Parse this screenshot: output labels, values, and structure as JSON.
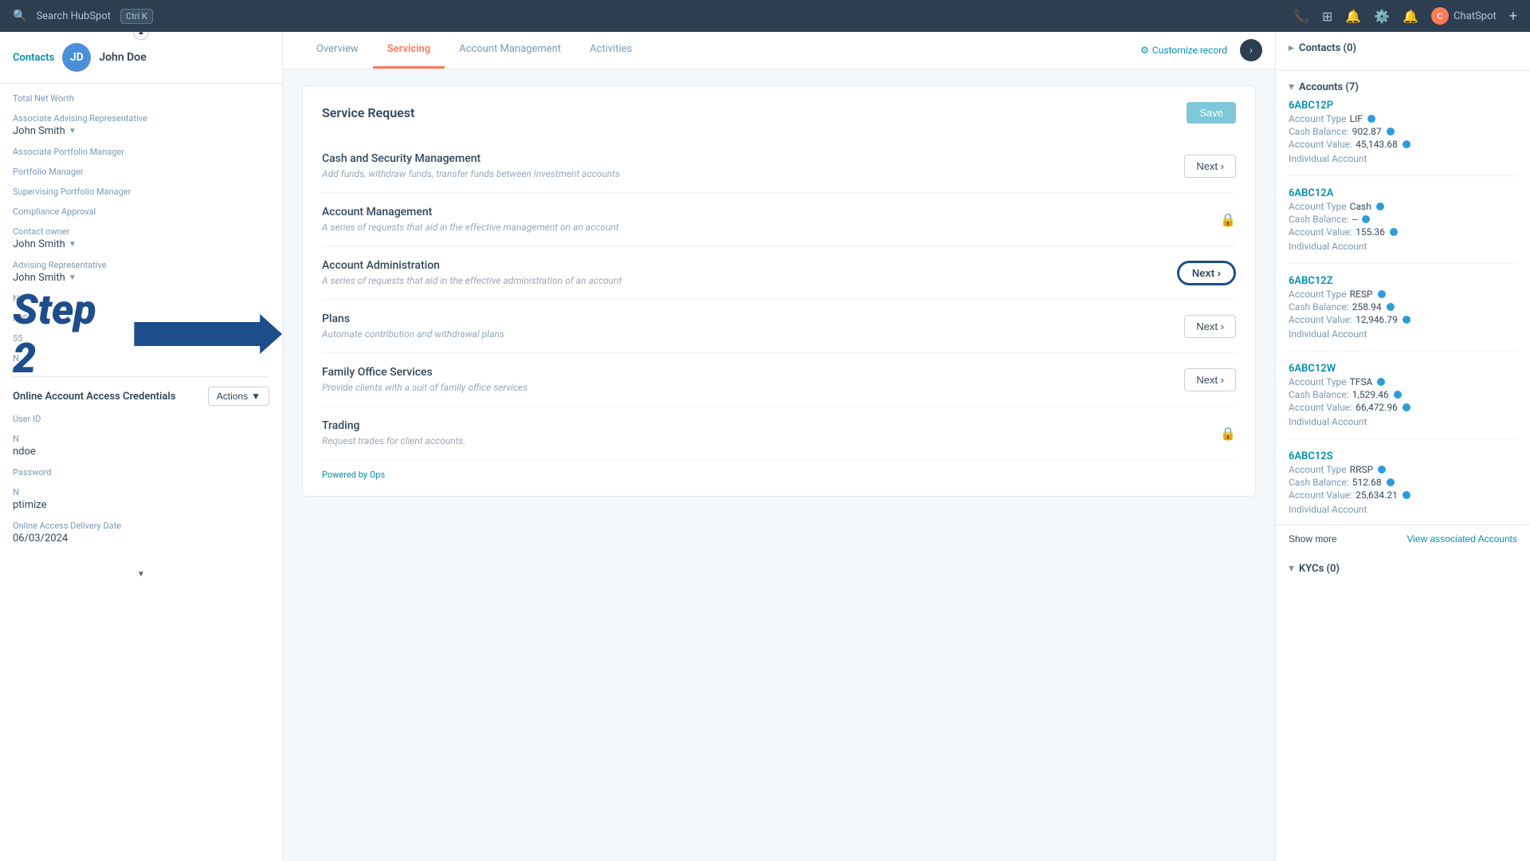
{
  "topbar": {
    "search_placeholder": "Search HubSpot",
    "shortcut": "Ctrl K",
    "chatspot_label": "ChatSpot",
    "expand_icon": "+"
  },
  "sidebar": {
    "contact_name": "John Doe",
    "avatar_initials": "JD",
    "fields": [
      {
        "label": "Total Net Worth",
        "value": ""
      },
      {
        "label": "Associate Advising Representative",
        "value": "John Smith",
        "dropdown": true
      },
      {
        "label": "Associate Portfolio Manager",
        "value": ""
      },
      {
        "label": "Portfolio Manager",
        "value": ""
      },
      {
        "label": "Supervising Portfolio Manager",
        "value": ""
      },
      {
        "label": "Compliance Approval",
        "value": ""
      },
      {
        "label": "Contact owner",
        "value": "John Smith",
        "dropdown": true
      },
      {
        "label": "Advising Representative",
        "value": "John Smith",
        "dropdown": true
      },
      {
        "label": "N",
        "value": ""
      },
      {
        "label": "P ID",
        "value": ""
      },
      {
        "label": "55",
        "value": ""
      },
      {
        "label": "N",
        "value": ""
      }
    ],
    "online_creds_title": "Online Account Access Credentials",
    "actions_label": "Actions",
    "cred_fields": [
      {
        "label": "User ID",
        "value": ""
      },
      {
        "label": "N",
        "value": "ndoe"
      },
      {
        "label": "Password",
        "value": ""
      },
      {
        "label": "N",
        "value": "ptimize"
      },
      {
        "label": "Online Access Delivery Date",
        "value": "06/03/2024"
      }
    ]
  },
  "tabs": [
    {
      "label": "Overview",
      "active": false
    },
    {
      "label": "Servicing",
      "active": true
    },
    {
      "label": "Account Management",
      "active": false
    },
    {
      "label": "Activities",
      "active": false
    }
  ],
  "customize_record": "Customize record",
  "service_request": {
    "title": "Service Request",
    "save_label": "Save",
    "items": [
      {
        "name": "Cash and Security Management",
        "desc": "Add funds, withdraw funds, transfer funds between investment accounts",
        "action": "Next",
        "locked": false
      },
      {
        "name": "Account Management",
        "desc": "A series of requests that aid in the effective management on an account",
        "action": null,
        "locked": true
      },
      {
        "name": "Account Administration",
        "desc": "A series of requests that aid in the effective administration of an account",
        "action": "Next",
        "highlighted": true,
        "locked": false
      },
      {
        "name": "Plans",
        "desc": "Automate contribution and withdrawal plans",
        "action": "Next",
        "locked": false
      },
      {
        "name": "Family Office Services",
        "desc": "Provide clients with a suit of family office services",
        "action": "Next",
        "locked": false
      },
      {
        "name": "Trading",
        "desc": "Request trades for client accounts.",
        "action": null,
        "locked": true
      }
    ],
    "powered_by": "Powered by",
    "powered_by_brand": "Ops"
  },
  "step2": {
    "label": "Step 2"
  },
  "right_sidebar": {
    "contacts_label": "Contacts (0)",
    "accounts_label": "Accounts (7)",
    "accounts": [
      {
        "id": "6ABC12P",
        "type_label": "Account Type",
        "type": "LIF",
        "cash_label": "Cash Balance:",
        "cash": "902.87",
        "value_label": "Account Value:",
        "value": "45,143.68",
        "account_type": "Individual Account"
      },
      {
        "id": "6ABC12A",
        "type_label": "Account Type",
        "type": "Cash",
        "cash_label": "Cash Balance:",
        "cash": "--",
        "value_label": "Account Value:",
        "value": "155.36",
        "account_type": "Individual Account"
      },
      {
        "id": "6ABC12Z",
        "type_label": "Account Type",
        "type": "RESP",
        "cash_label": "Cash Balance:",
        "cash": "258.94",
        "value_label": "Account Value:",
        "value": "12,946.79",
        "account_type": "Individual Account"
      },
      {
        "id": "6ABC12W",
        "type_label": "Account Type",
        "type": "TFSA",
        "cash_label": "Cash Balance:",
        "cash": "1,529.46",
        "value_label": "Account Value:",
        "value": "66,472.96",
        "account_type": "Individual Account"
      },
      {
        "id": "6ABC12S",
        "type_label": "Account Type",
        "type": "RRSP",
        "cash_label": "Cash Balance:",
        "cash": "512.68",
        "value_label": "Account Value:",
        "value": "25,634.21",
        "account_type": "Individual Account"
      }
    ],
    "show_more": "Show more",
    "view_associated": "View associated Accounts",
    "kycs_label": "KYCs (0)"
  }
}
